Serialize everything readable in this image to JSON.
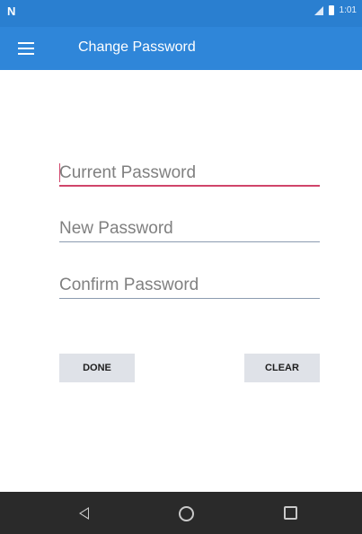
{
  "status_bar": {
    "left_icon": "N",
    "time": "1:01"
  },
  "app_bar": {
    "title": "Change Password",
    "menu_icon": "hamburger-menu-icon"
  },
  "form": {
    "current_password": {
      "placeholder": "Current Password",
      "value": ""
    },
    "new_password": {
      "placeholder": "New Password",
      "value": ""
    },
    "confirm_password": {
      "placeholder": "Confirm Password",
      "value": ""
    }
  },
  "buttons": {
    "done": "DONE",
    "clear": "CLEAR"
  },
  "colors": {
    "accent": "#d0446a",
    "primary": "#2f86d9",
    "status_bar": "#2a7fd0",
    "nav_bar": "#2a2a2a"
  }
}
